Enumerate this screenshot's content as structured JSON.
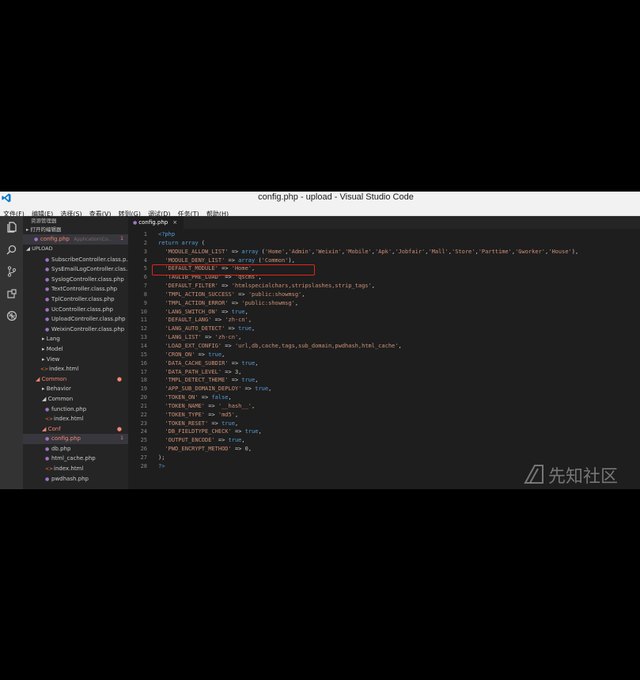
{
  "window": {
    "title": "config.php - upload - Visual Studio Code",
    "menu": [
      "文件(F)",
      "编辑(E)",
      "选择(S)",
      "查看(V)",
      "转到(G)",
      "调试(D)",
      "任务(T)",
      "帮助(H)"
    ]
  },
  "activity_bar": [
    "files-icon",
    "search-icon",
    "source-control-icon",
    "extensions-icon",
    "debug-icon"
  ],
  "sidebar": {
    "header": "资源管理器",
    "open_editors_label": "▸ 打开的编辑器",
    "open_file": "config.php",
    "open_file_path": "Application\\Co...",
    "open_file_count": "1",
    "root_label": "◢ UPLOAD",
    "items": [
      {
        "label": "SubscribeController.class.p...",
        "type": "php",
        "indent": 28,
        "red": false,
        "mark": ""
      },
      {
        "label": "SysEmailLogController.clas...",
        "type": "php",
        "indent": 28,
        "red": false,
        "mark": ""
      },
      {
        "label": "SyslogController.class.php",
        "type": "php",
        "indent": 28,
        "red": false,
        "mark": ""
      },
      {
        "label": "TextController.class.php",
        "type": "php",
        "indent": 28,
        "red": false,
        "mark": ""
      },
      {
        "label": "TplController.class.php",
        "type": "php",
        "indent": 28,
        "red": false,
        "mark": ""
      },
      {
        "label": "UcController.class.php",
        "type": "php",
        "indent": 28,
        "red": false,
        "mark": ""
      },
      {
        "label": "UploadController.class.php",
        "type": "php",
        "indent": 28,
        "red": false,
        "mark": ""
      },
      {
        "label": "WeixinController.class.php",
        "type": "php",
        "indent": 28,
        "red": false,
        "mark": ""
      },
      {
        "label": "▸ Lang",
        "type": "folder",
        "indent": 24,
        "red": false,
        "mark": ""
      },
      {
        "label": "▸ Model",
        "type": "folder",
        "indent": 24,
        "red": false,
        "mark": ""
      },
      {
        "label": "▸ View",
        "type": "folder",
        "indent": 24,
        "red": false,
        "mark": ""
      },
      {
        "label": "index.html",
        "type": "html",
        "indent": 22,
        "red": false,
        "mark": ""
      },
      {
        "label": "◢ Common",
        "type": "folder",
        "indent": 16,
        "red": true,
        "mark": "●"
      },
      {
        "label": "▸ Behavior",
        "type": "folder",
        "indent": 24,
        "red": false,
        "mark": ""
      },
      {
        "label": "◢ Common",
        "type": "folder",
        "indent": 24,
        "red": false,
        "mark": ""
      },
      {
        "label": "function.php",
        "type": "php",
        "indent": 28,
        "red": false,
        "mark": ""
      },
      {
        "label": "index.html",
        "type": "html",
        "indent": 28,
        "red": false,
        "mark": ""
      },
      {
        "label": "◢ Conf",
        "type": "folder",
        "indent": 24,
        "red": true,
        "mark": "●"
      },
      {
        "label": "config.php",
        "type": "php",
        "indent": 28,
        "red": true,
        "mark": "1",
        "selected": true
      },
      {
        "label": "db.php",
        "type": "php",
        "indent": 28,
        "red": false,
        "mark": ""
      },
      {
        "label": "html_cache.php",
        "type": "php",
        "indent": 28,
        "red": false,
        "mark": ""
      },
      {
        "label": "index.html",
        "type": "html",
        "indent": 28,
        "red": false,
        "mark": ""
      },
      {
        "label": "pwdhash.php",
        "type": "php",
        "indent": 28,
        "red": false,
        "mark": ""
      }
    ]
  },
  "editor": {
    "tab_label": "config.php",
    "tab_close": "×",
    "lines": [
      "<?php",
      "return array (",
      "  'MODULE_ALLOW_LIST' => array ('Home','Admin','Weixin','Mobile','Apk','Jobfair','Mall','Store','Parttime','Gworker','House'),",
      "  'MODULE_DENY_LIST' => array ('Common'),",
      "  'DEFAULT_MODULE' => 'Home',",
      "  'TAGLIB_PRE_LOAD' => 'qscms',",
      "  'DEFAULT_FILTER' => 'htmlspecialchars,stripslashes,strip_tags',",
      "  'TMPL_ACTION_SUCCESS' => 'public:showmsg',",
      "  'TMPL_ACTION_ERROR' => 'public:showmsg',",
      "  'LANG_SWITCH_ON' => true,",
      "  'DEFAULT_LANG' => 'zh-cn',",
      "  'LANG_AUTO_DETECT' => true,",
      "  'LANG_LIST' => 'zh-cn',",
      "  'LOAD_EXT_CONFIG' => 'url,db,cache,tags,sub_domain,pwdhash,html_cache',",
      "  'CRON_ON' => true,",
      "  'DATA_CACHE_SUBDIR' => true,",
      "  'DATA_PATH_LEVEL' => 3,",
      "  'TMPL_DETECT_THEME' => true,",
      "  'APP_SUB_DOMAIN_DEPLOY' => true,",
      "  'TOKEN_ON' => false,",
      "  'TOKEN_NAME' => '__hash__',",
      "  'TOKEN_TYPE' => 'md5',",
      "  'TOKEN_RESET' => true,",
      "  'DB_FIELDTYPE_CHECK' => true,",
      "  'OUTPUT_ENCODE' => true,",
      "  'PWD_ENCRYPT_METHOD' => 0,",
      ");",
      "?>"
    ]
  },
  "watermark": {
    "text": "先知社区"
  },
  "colors": {
    "highlight_box": "#e0261c",
    "editor_bg": "#1e1e1e",
    "sidebar_bg": "#252526",
    "activity_bg": "#333333"
  }
}
